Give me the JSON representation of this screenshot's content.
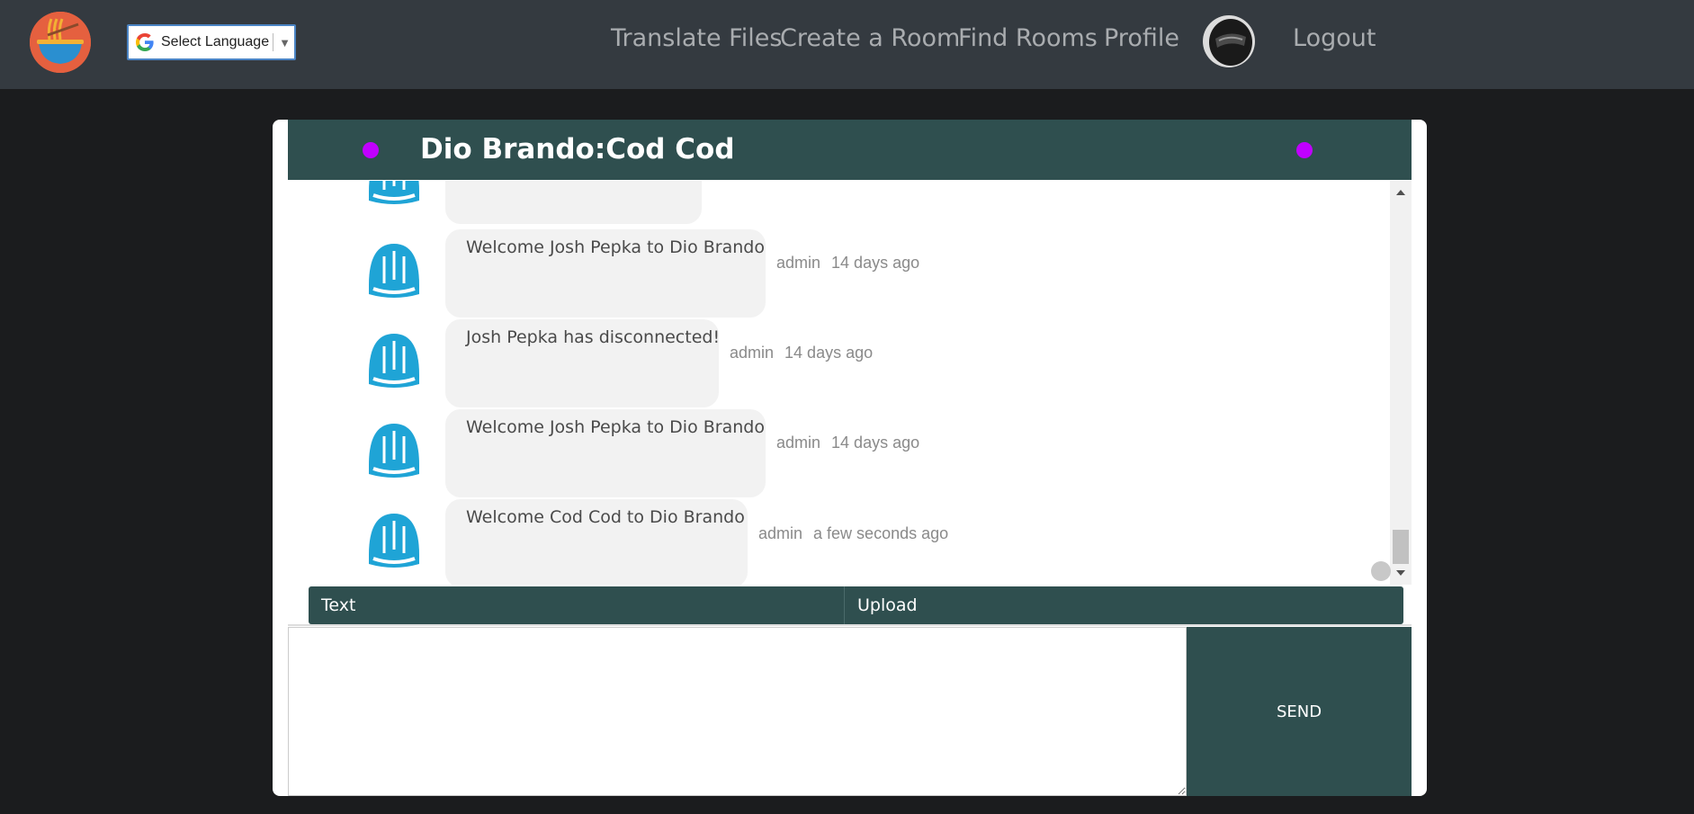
{
  "navbar": {
    "logo_icon": "noodle-bowl-icon",
    "language_select": {
      "label": "Select Language",
      "icon": "google-g-icon"
    },
    "links": [
      "Translate Files",
      "Create a Room",
      "Find Rooms",
      "Profile"
    ],
    "logout_label": "Logout",
    "avatar_icon": "helmet-avatar-icon"
  },
  "chat": {
    "room_title": "Dio Brando:Cod Cod",
    "status_dot_color": "#c000ff",
    "header_color": "#2f4f4f",
    "messages": [
      {
        "text": "",
        "author": "",
        "time": ""
      },
      {
        "text": "Welcome Josh Pepka to Dio Brando",
        "author": "admin",
        "time": "14 days ago"
      },
      {
        "text": "Josh Pepka has disconnected!",
        "author": "admin",
        "time": "14 days ago"
      },
      {
        "text": "Welcome Josh Pepka to Dio Brando",
        "author": "admin",
        "time": "14 days ago"
      },
      {
        "text": "Welcome Cod Cod to Dio Brando",
        "author": "admin",
        "time": "a few seconds ago"
      }
    ],
    "avatar_icon": "admin-helmet-avatar-icon"
  },
  "composer": {
    "tabs": [
      "Text",
      "Upload"
    ],
    "input_value": "",
    "send_label": "SEND"
  }
}
